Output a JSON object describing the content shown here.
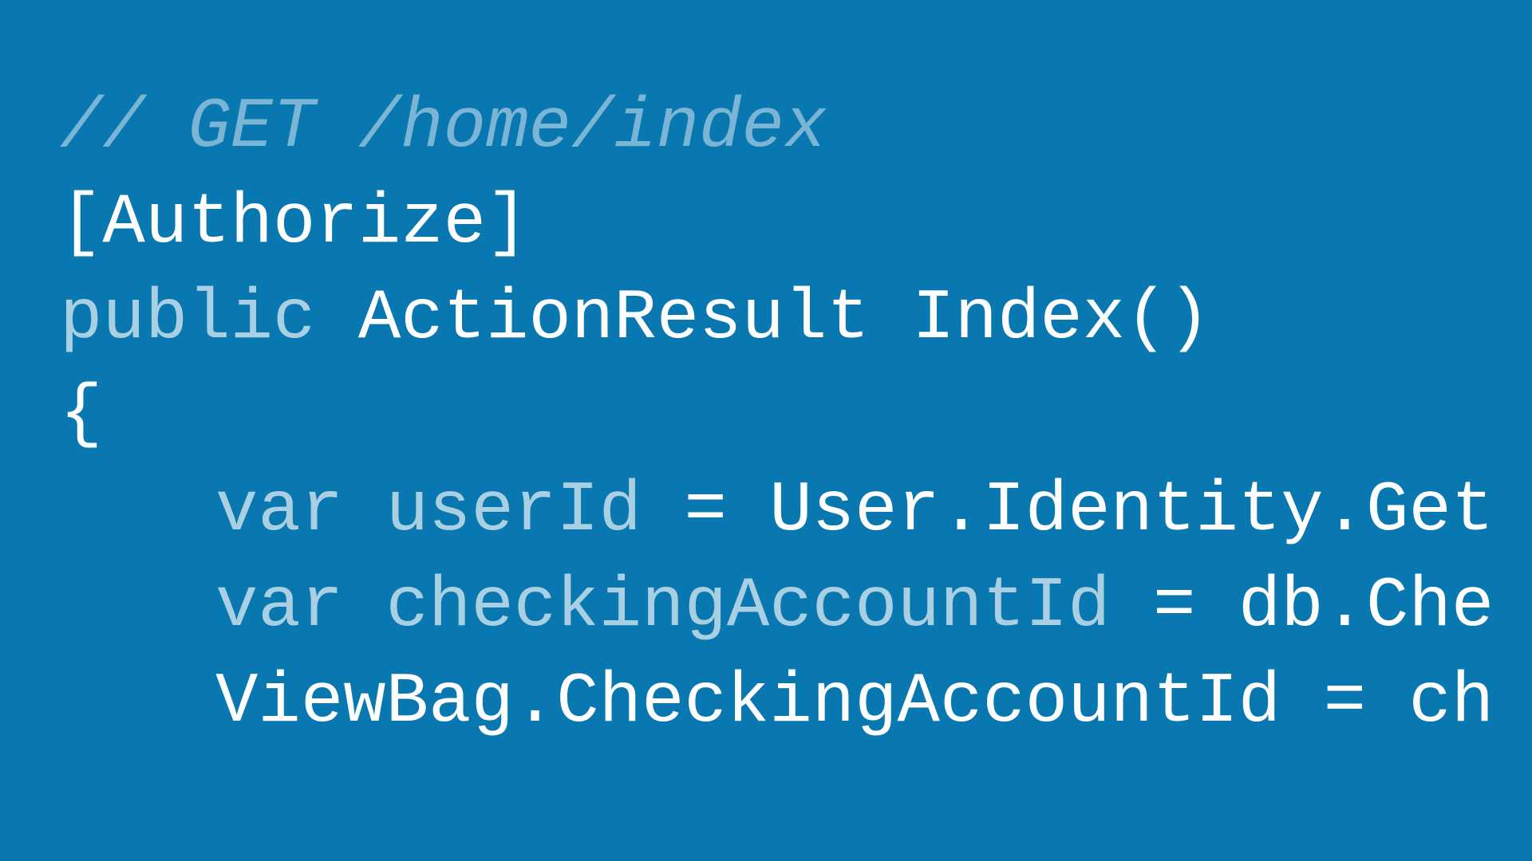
{
  "code": {
    "line1_comment": "// GET /home/index",
    "line2_attribute": "[Authorize]",
    "line3_keyword": "public",
    "line3_rest": " ActionResult Index()",
    "line4_brace": "{",
    "line5_var": "var",
    "line5_id": " userId",
    "line5_rest": " = User.Identity.Get",
    "line6_var": "var",
    "line6_id": " checkingAccountId",
    "line6_rest": " = db.Che",
    "line7_rest": "ViewBag.CheckingAccountId = ch"
  }
}
